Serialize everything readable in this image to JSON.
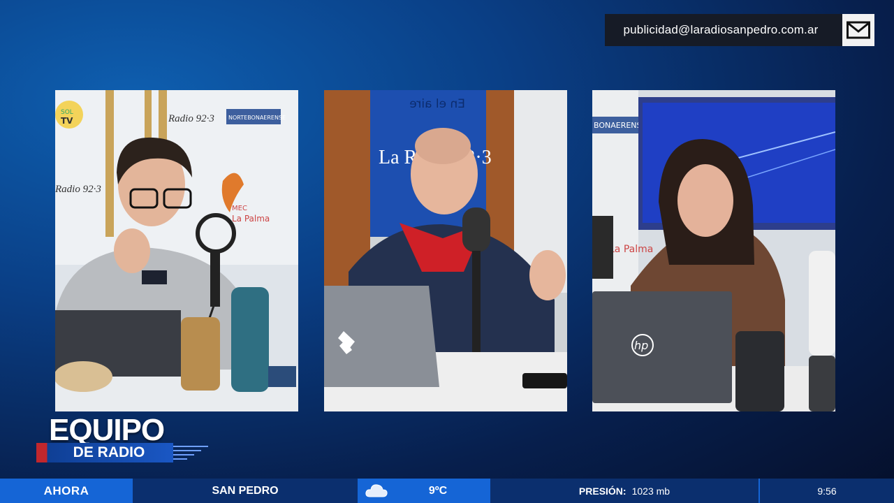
{
  "contact": {
    "email": "publicidad@laradiosanpedro.com.ar",
    "icon": "envelope-icon"
  },
  "panels": [
    {
      "name": "camera-left",
      "signs": {
        "sol": "SOL",
        "tv": "TV",
        "radio": "Radio 92·3",
        "bonaerense": "NORTEBONAERENSE",
        "mec": "MEC",
        "lapalma": "La Palma"
      }
    },
    {
      "name": "camera-center",
      "signs": {
        "enelaire": "En el aire",
        "laradio": "La Radio 92·3"
      }
    },
    {
      "name": "camera-right",
      "signs": {
        "bonaerense": "BONAERENSE",
        "lapalma": "La Palma",
        "hp": "hp"
      }
    }
  ],
  "brand": {
    "title": "EQUIPO",
    "subtitle": "DE RADIO",
    "accent": "#c1272d"
  },
  "ticker": {
    "now": "AHORA",
    "city": "SAN PEDRO",
    "weather_icon": "cloud-icon",
    "temperature": "9ºC",
    "pressure_label": "PRESIÓN:",
    "pressure_value": "1023 mb",
    "time": "9:56"
  },
  "colors": {
    "accent_blue": "#1565d6",
    "dark_blue": "#0b2f6e"
  }
}
